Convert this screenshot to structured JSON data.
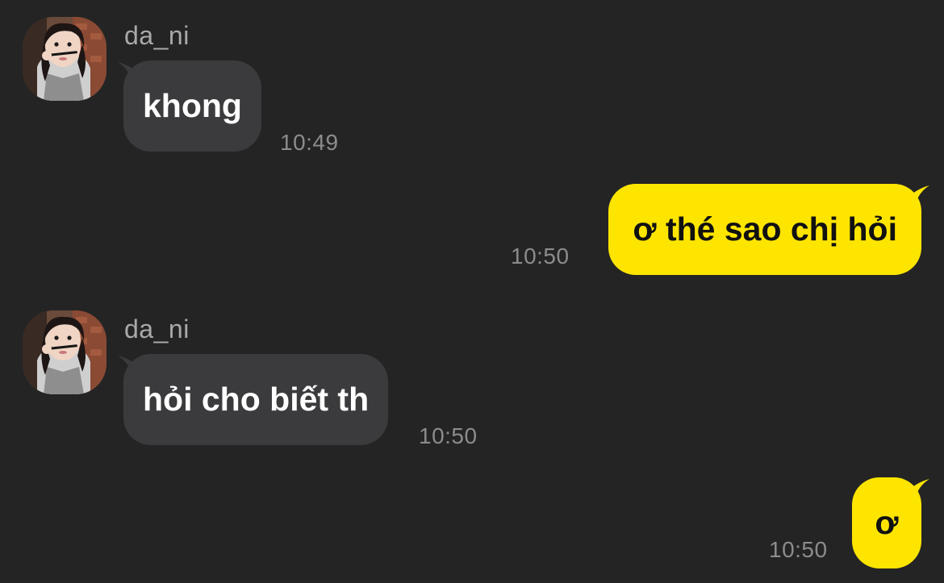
{
  "conversation": {
    "messages": [
      {
        "sender": "da_ni",
        "text": "khong",
        "time": "10:49",
        "direction": "incoming"
      },
      {
        "text": "ơ thé sao chị hỏi",
        "time": "10:50",
        "direction": "outgoing"
      },
      {
        "sender": "da_ni",
        "text": "hỏi cho biết th",
        "time": "10:50",
        "direction": "incoming"
      },
      {
        "text": "ơ",
        "time": "10:50",
        "direction": "outgoing"
      }
    ]
  },
  "colors": {
    "background": "#242424",
    "incoming_bubble": "#3b3b3d",
    "outgoing_bubble": "#fee500",
    "sender_name": "#a9a9a9",
    "timestamp": "#8c8c8c"
  },
  "icons": {
    "avatar": "user-avatar-photo"
  }
}
